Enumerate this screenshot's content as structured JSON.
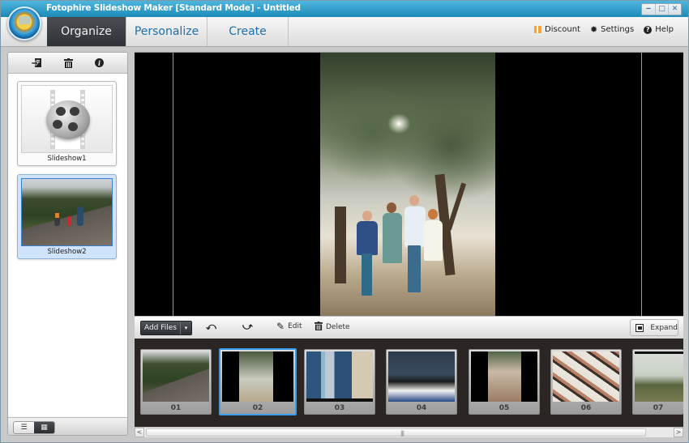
{
  "window": {
    "title": "Fotophire Slideshow Maker [Standard Mode] - Untitled",
    "controls": {
      "minimize": "‒",
      "maximize": "□",
      "close": "✕"
    }
  },
  "nav": {
    "tabs": [
      {
        "label": "Organize",
        "active": true
      },
      {
        "label": "Personalize",
        "active": false
      },
      {
        "label": "Create",
        "active": false
      }
    ],
    "right_links": [
      {
        "label": "Discount",
        "icon": "gift-icon"
      },
      {
        "label": "Settings",
        "icon": "gear-icon"
      },
      {
        "label": "Help",
        "icon": "help-icon"
      }
    ]
  },
  "sidebar": {
    "toolbar_icons": [
      "import-icon",
      "trash-icon",
      "info-icon"
    ],
    "slideshows": [
      {
        "label": "Slideshow1",
        "thumbnail": "film-reel",
        "selected": false
      },
      {
        "label": "Slideshow2",
        "thumbnail": "photo-forest-path",
        "selected": true
      }
    ],
    "view_toggle": {
      "list": "☰",
      "grid": "▦",
      "active": "grid"
    }
  },
  "toolbar": {
    "add_files": "Add Files",
    "add_files_dropdown": "▾",
    "rotate_left_icon": "rotate-left-icon",
    "rotate_right_icon": "rotate-right-icon",
    "edit": "Edit",
    "delete": "Delete",
    "expand": "Expand"
  },
  "timeline": {
    "slides": [
      {
        "num": "01",
        "selected": false
      },
      {
        "num": "02",
        "selected": true
      },
      {
        "num": "03",
        "selected": false
      },
      {
        "num": "04",
        "selected": false
      },
      {
        "num": "05",
        "selected": false
      },
      {
        "num": "06",
        "selected": false
      },
      {
        "num": "07",
        "selected": false
      }
    ],
    "scroll": {
      "left_arrow": "<",
      "right_arrow": ">",
      "grip": "|||"
    }
  },
  "colors": {
    "titlebar": "#2a9dcc",
    "active_tab": "#3a3d41",
    "tab_text": "#1f6fa8",
    "selection": "#3a9ef0"
  }
}
